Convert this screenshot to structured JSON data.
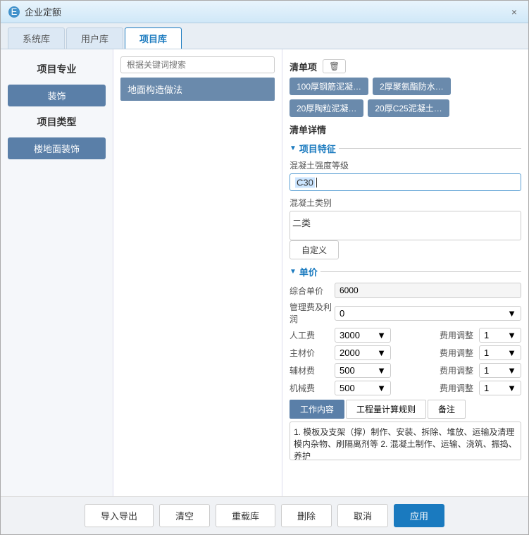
{
  "window": {
    "title": "企业定额",
    "close_label": "×"
  },
  "tabs": [
    {
      "id": "system",
      "label": "系统库"
    },
    {
      "id": "user",
      "label": "用户库"
    },
    {
      "id": "project",
      "label": "项目库",
      "active": true
    }
  ],
  "left_panel": {
    "section1_title": "项目专业",
    "btn1_label": "装饰",
    "section2_title": "项目类型",
    "btn2_label": "楼地面装饰"
  },
  "search": {
    "placeholder": "根据关键词搜索"
  },
  "list_items": [
    {
      "label": "地面构造做法"
    }
  ],
  "qingdan": {
    "label": "清单项",
    "trash_label": "🗑",
    "tags": [
      {
        "label": "100厚钢筋泥凝…"
      },
      {
        "label": "2厚聚氨酯防水…"
      },
      {
        "label": "20厚陶粒泥凝…"
      },
      {
        "label": "20厚C25泥凝土…"
      }
    ]
  },
  "qingdan_detail": {
    "label": "清单详情"
  },
  "project_features": {
    "header": "项目特征",
    "concrete_label": "混凝土强度等级",
    "concrete_value": "C30",
    "concrete_type_label": "混凝土类别",
    "concrete_type_value": "二类",
    "custom_btn_label": "自定义"
  },
  "unit_price": {
    "header": "单价",
    "zhonghe_label": "综合单价",
    "zhonghe_value": "6000",
    "guanli_label": "管理费及利润",
    "guanli_value": "0",
    "rows": [
      {
        "label": "人工费",
        "value": "3000",
        "adj_label": "费用调整",
        "adj_value": "1"
      },
      {
        "label": "主材价",
        "value": "2000",
        "adj_label": "费用调整",
        "adj_value": "1"
      },
      {
        "label": "辅材费",
        "value": "500",
        "adj_label": "费用调整",
        "adj_value": "1"
      },
      {
        "label": "机械费",
        "value": "500",
        "adj_label": "费用调整",
        "adj_value": "1"
      }
    ]
  },
  "inner_tabs": [
    {
      "label": "工作内容",
      "active": true
    },
    {
      "label": "工程量计算规则"
    },
    {
      "label": "备注"
    }
  ],
  "work_content": "1. 模板及支架（撑）制作、安装、拆除、堆放、运输及清理模内杂物、刷隔离剂等\n2. 混凝土制作、运输、浇筑、振捣、养护",
  "bottom_buttons": [
    {
      "label": "导入导出",
      "primary": false
    },
    {
      "label": "清空",
      "primary": false
    },
    {
      "label": "重载库",
      "primary": false
    },
    {
      "label": "删除",
      "primary": false
    },
    {
      "label": "取消",
      "primary": false
    },
    {
      "label": "应用",
      "primary": true
    }
  ]
}
